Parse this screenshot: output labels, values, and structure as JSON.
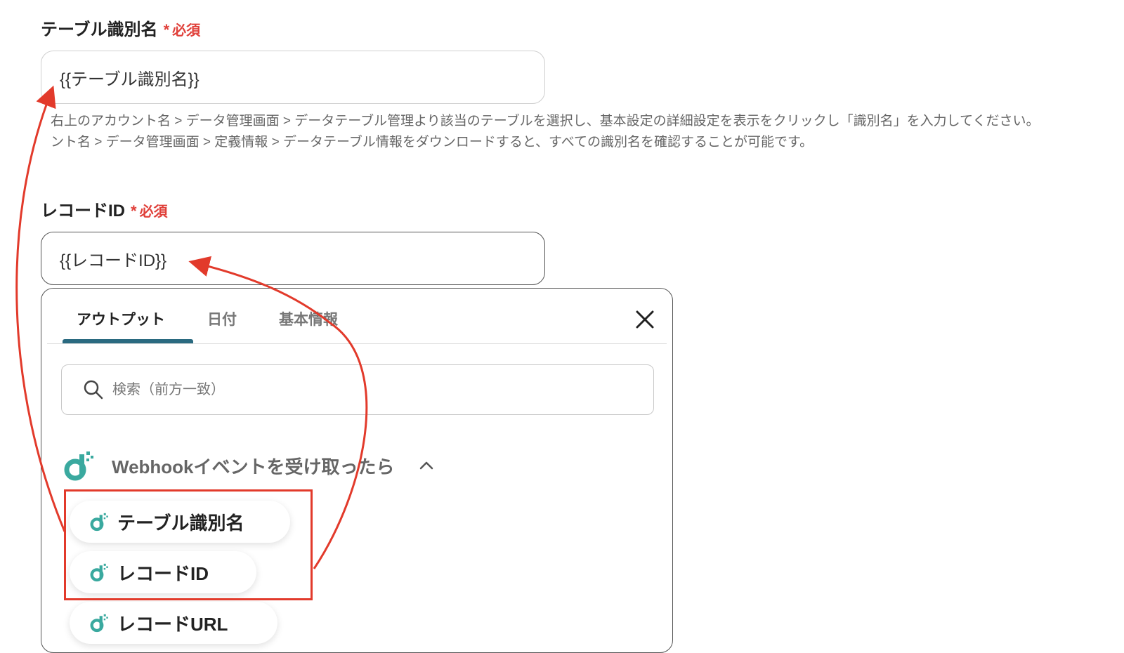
{
  "field1": {
    "label": "テーブル識別名",
    "required": "必須",
    "asterisk": "*",
    "value": "{{テーブル識別名}}",
    "help_line1": "右上のアカウント名 > データ管理画面 > データテーブル管理より該当のテーブルを選択し、基本設定の詳細設定を表示をクリックし「識別名」を入力してください。",
    "help_line2": "ント名 > データ管理画面 > 定義情報 > データテーブル情報をダウンロードすると、すべての識別名を確認することが可能です。"
  },
  "field2": {
    "label": "レコードID",
    "required": "必須",
    "asterisk": "*",
    "value": "{{レコードID}}"
  },
  "panel": {
    "tabs": [
      "アウトプット",
      "日付",
      "基本情報"
    ],
    "active_tab": "アウトプット",
    "search_placeholder": "検索（前方一致）",
    "group_title": "Webhookイベントを受け取ったら",
    "items": [
      "テーブル識別名",
      "レコードID",
      "レコードURL"
    ]
  },
  "colors": {
    "required_red": "#e0403a",
    "annotation_red": "#e23a2b",
    "tab_accent": "#2a6a80",
    "brand_teal": "#3aa99f"
  }
}
